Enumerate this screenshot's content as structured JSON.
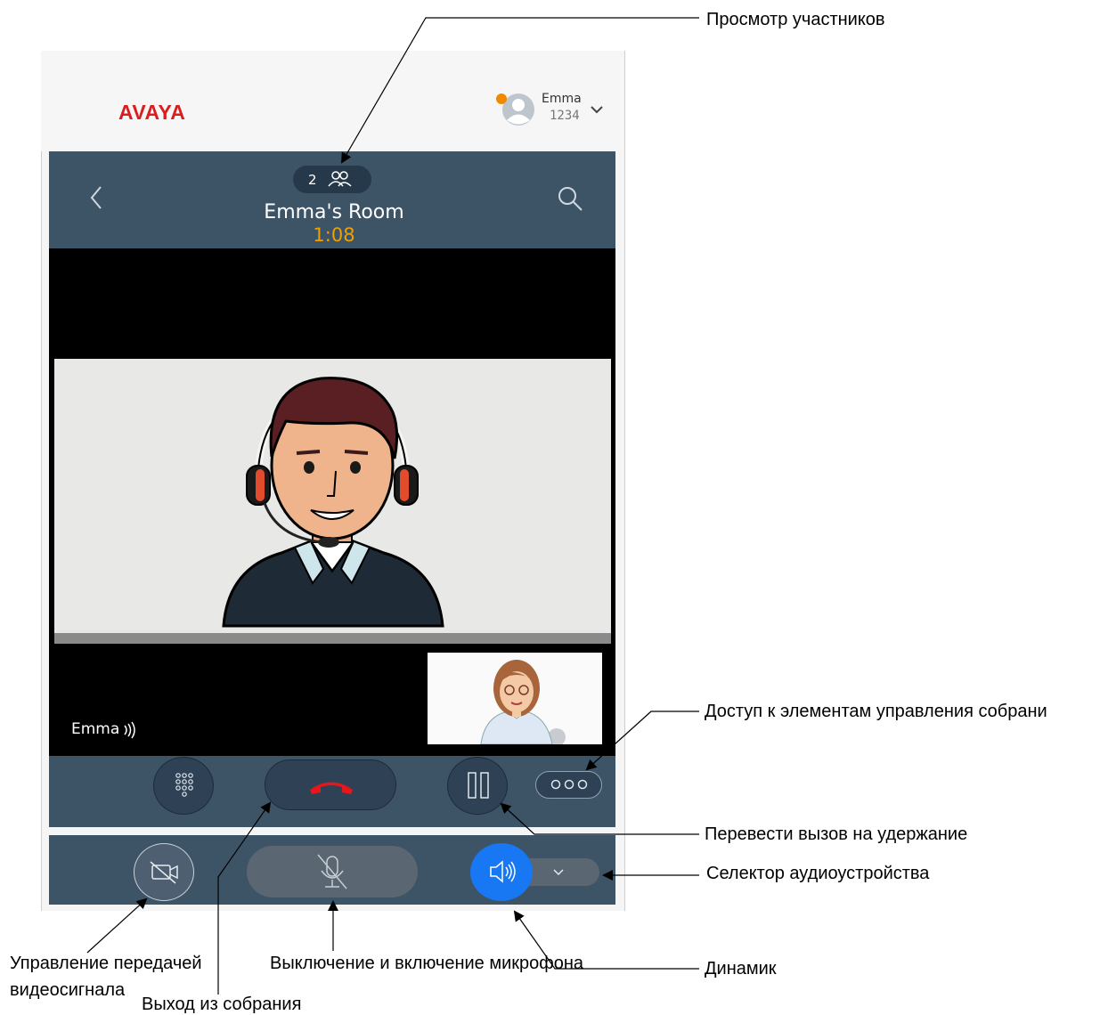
{
  "header": {
    "logo_text": "AVAYA",
    "user_name": "Emma",
    "user_extension": "1234",
    "avatar_badge_color": "#f08a00"
  },
  "call": {
    "participant_count": "2",
    "room_title": "Emma's Room",
    "timer": "1:08",
    "self_view_name": "Emma"
  },
  "icons": {
    "back": "chevron-left-icon",
    "search": "search-icon",
    "participants": "people-icon",
    "dialpad": "dialpad-icon",
    "end_call": "hangup-icon",
    "hold": "pause-icon",
    "more": "more-icon",
    "video": "video-off-icon",
    "mic": "mic-muted-icon",
    "speaker": "speaker-icon",
    "speaker_dropdown": "chevron-down-icon"
  },
  "colors": {
    "brand_red": "#d81e1e",
    "bar_blue": "#3d5366",
    "timer_orange": "#f0a000",
    "speaker_active": "#1877f2",
    "end_call_red": "#e8151c"
  },
  "callouts": {
    "participants": "Просмотр участников",
    "meeting_controls": "Доступ к элементам управления собрани",
    "hold": "Перевести вызов на удержание",
    "audio_selector": "Селектор аудиоустройства",
    "speaker": "Динамик",
    "video_line1": "Управление передачей",
    "video_line2": "видеосигнала",
    "leave": "Выход из собрания",
    "mute": "Выключение и включение микрофона"
  }
}
